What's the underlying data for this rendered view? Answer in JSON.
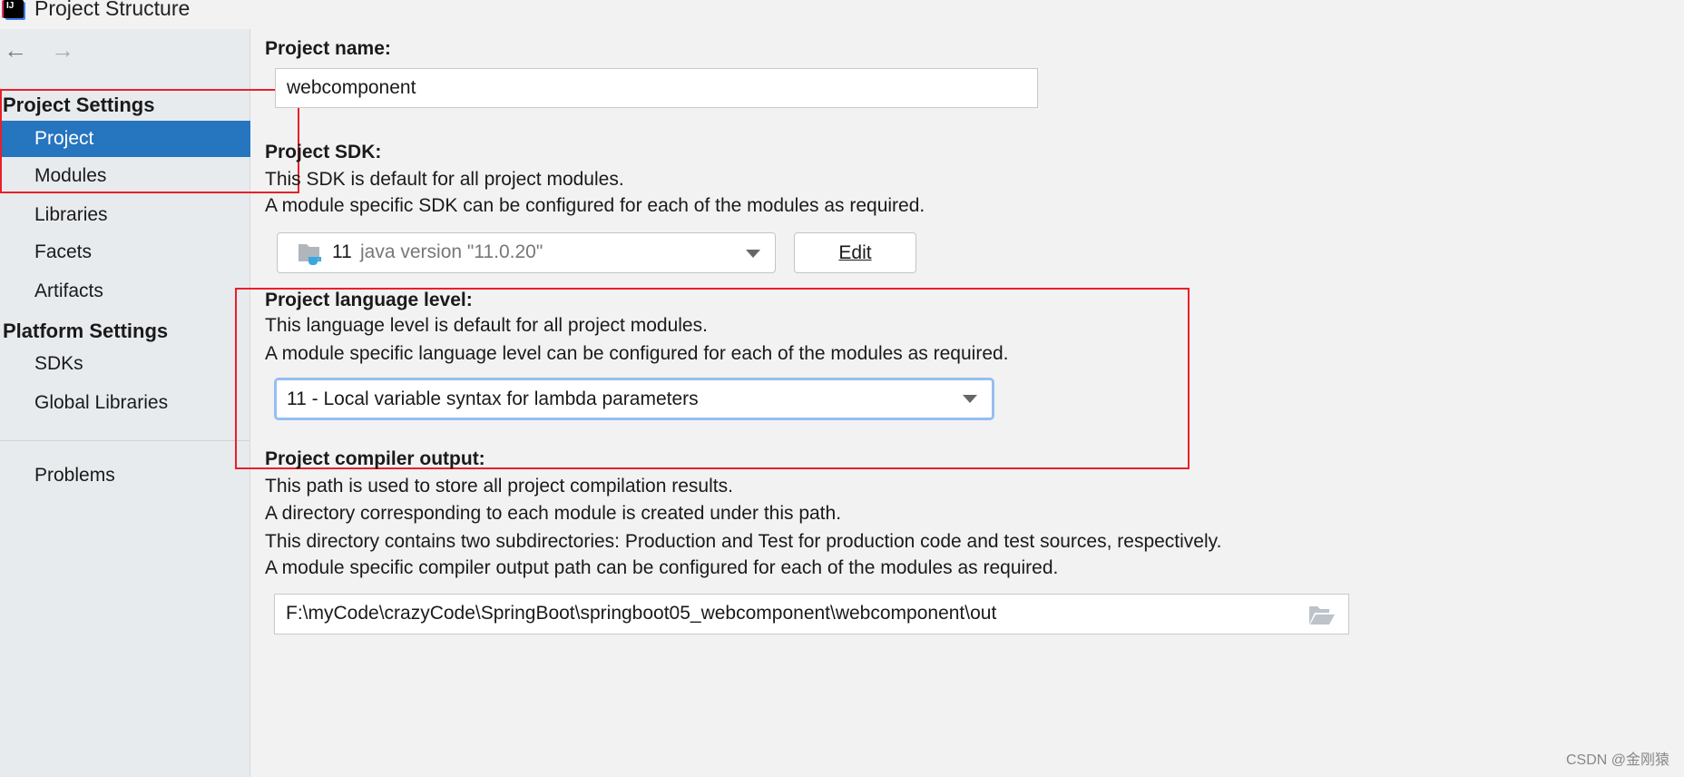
{
  "window": {
    "title": "Project Structure",
    "app_icon": "intellij-idea-icon"
  },
  "nav": {
    "back": "←",
    "forward": "→"
  },
  "sidebar": {
    "project_settings_header": "Project Settings",
    "project_items": [
      {
        "label": "Project",
        "selected": true
      },
      {
        "label": "Modules"
      },
      {
        "label": "Libraries"
      },
      {
        "label": "Facets"
      },
      {
        "label": "Artifacts"
      }
    ],
    "platform_settings_header": "Platform Settings",
    "platform_items": [
      {
        "label": "SDKs"
      },
      {
        "label": "Global Libraries"
      }
    ],
    "problems": "Problems",
    "selected_color": "#2675bf"
  },
  "main": {
    "project_name": {
      "label": "Project name:",
      "value": "webcomponent"
    },
    "sdk": {
      "label": "Project SDK:",
      "lines": [
        "This SDK is default for all project modules.",
        "A module specific SDK can be configured for each of the modules as required."
      ],
      "version": "11",
      "detail": "java version \"11.0.20\"",
      "edit_label": "Edit"
    },
    "language_level": {
      "label": "Project language level:",
      "lines": [
        "This language level is default for all project modules.",
        "A module specific language level can be configured for each of the modules as required."
      ],
      "value": "11 - Local variable syntax for lambda parameters"
    },
    "compiler_output": {
      "label": "Project compiler output:",
      "lines": [
        "This path is used to store all project compilation results.",
        "A directory corresponding to each module is created under this path.",
        "This directory contains two subdirectories: Production and Test for production code and test sources, respectively.",
        "A module specific compiler output path can be configured for each of the modules as required."
      ],
      "value": "F:\\myCode\\crazyCode\\SpringBoot\\springboot05_webcomponent\\webcomponent\\out"
    }
  },
  "annotation_color": "#e8202a",
  "watermark": "CSDN @金刚猿"
}
